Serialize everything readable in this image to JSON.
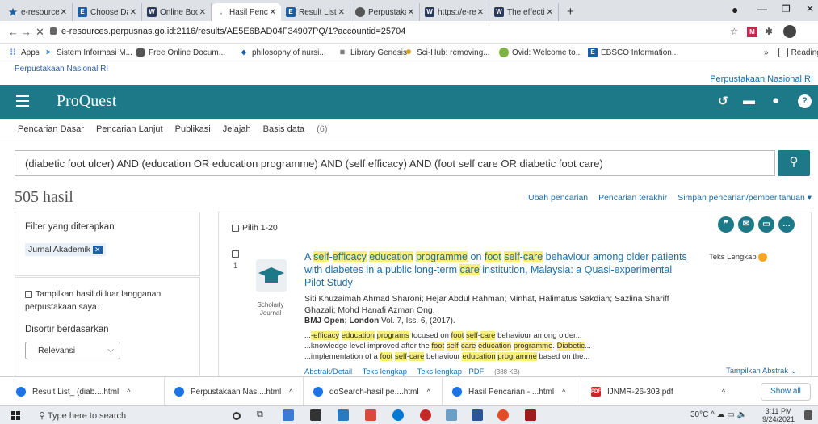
{
  "browser": {
    "tabs": [
      {
        "label": "e-resources.p",
        "active": false
      },
      {
        "label": "Choose Datab",
        "active": false
      },
      {
        "label": "Online Books",
        "active": false
      },
      {
        "label": "Hasil Pencaria",
        "active": true
      },
      {
        "label": "Result List: (di",
        "active": false
      },
      {
        "label": "Perpustakaan",
        "active": false
      },
      {
        "label": "https://e-reso",
        "active": false
      },
      {
        "label": "The effective",
        "active": false
      }
    ],
    "url": "e-resources.perpusnas.go.id:2116/results/AE5E6BAD04F34907PQ/1?accountid=25704",
    "bookmarks": [
      "Apps",
      "Sistem Informasi M...",
      "Free Online Docum...",
      "philosophy of nursi...",
      "Library Genesis",
      "Sci-Hub: removing...",
      "Ovid: Welcome to...",
      "EBSCO Information..."
    ],
    "reading_list": "Reading li"
  },
  "page": {
    "logo_alt": "Perpustakaan Nasional RI",
    "site_name": "Perpustakaan Nasional RI",
    "brand": "ProQuest",
    "nav": [
      "Pencarian Dasar",
      "Pencarian Lanjut",
      "Publikasi",
      "Jelajah",
      "Basis data"
    ],
    "db_count": "(6)",
    "query": "(diabetic foot ulcer) AND (education OR education programme) AND (self efficacy) AND (foot self care OR diabetic foot care)",
    "hits": "505 hasil",
    "links": [
      "Ubah pencarian",
      "Pencarian terakhir",
      "Simpan pencarian/pemberitahuan ▾"
    ],
    "filter_title": "Filter yang diterapkan",
    "filter_chip": "Jurnal Akademik",
    "show_outside": "Tampilkan hasil di luar langganan perpustakaan saya.",
    "sort_label": "Disortir berdasarkan",
    "sort_value": "Relevansi",
    "select_label": "Pilih 1-20",
    "result": {
      "number": "1",
      "doctype": "Scholarly Journal",
      "full_text": "Teks Lengkap",
      "authors": "Siti Khuzaimah Ahmad Sharoni; Hejar Abdul Rahman; Minhat, Halimatus Sakdiah; Sazlina Shariff Ghazali; Mohd Hanafi Azman Ong.",
      "journal": "BMJ Open; London",
      "details": "Vol. 7, Iss. 6,  (2017).",
      "links": [
        "Abstrak/Detail",
        "Teks lengkap",
        "Teks lengkap - PDF"
      ],
      "pdf_size": "(388 KB)",
      "abstract_link": "Tampilkan Abstrak ⌄"
    }
  },
  "downloads": [
    "Result List_ (diab....html",
    "Perpustakaan Nas....html",
    "doSearch-hasil pe....html",
    "Hasil Pencarian -....html",
    "IJNMR-26-303.pdf"
  ],
  "show_all": "Show all",
  "taskbar": {
    "search": "Type here to search",
    "temp": "30°C",
    "time": "3:11 PM",
    "date": "9/24/2021"
  },
  "colors": {
    "teal": "#1d7887",
    "link": "#1a6da8",
    "highlight": "#fbef7c"
  }
}
